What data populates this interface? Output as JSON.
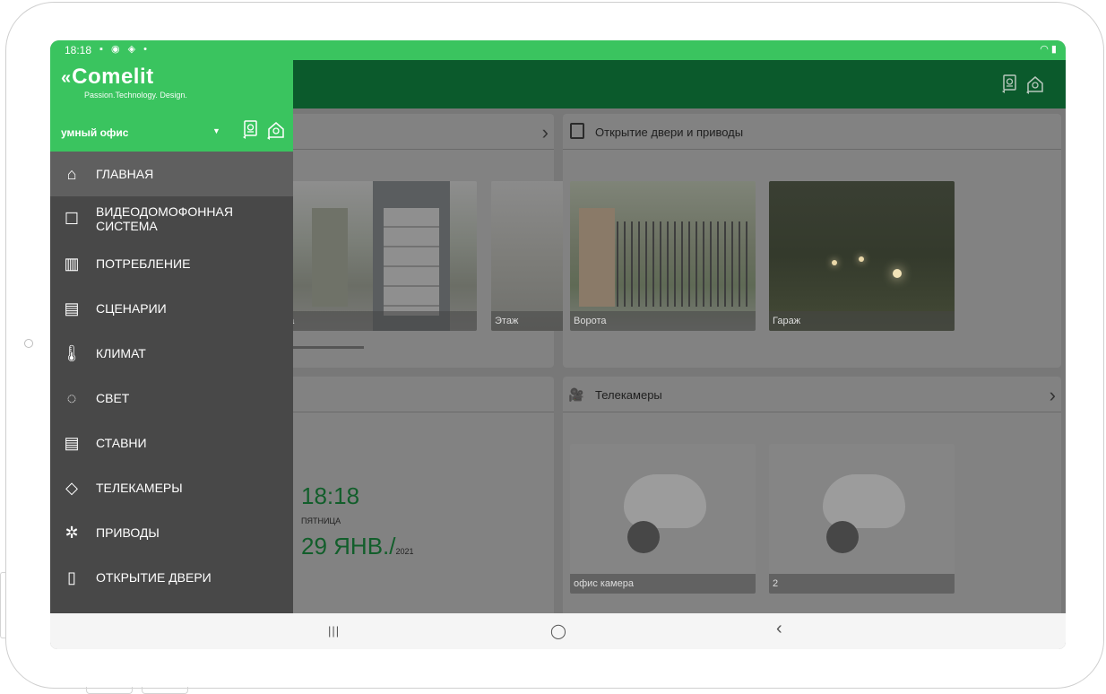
{
  "status_bar": {
    "time": "18:18",
    "icons": "▪ ◉ ◈ •",
    "right_icons": "◠ ▮"
  },
  "drawer": {
    "brand": "Comelit",
    "brand_mark": "«",
    "tagline": "Passion.Technology. Design.",
    "site_name": "умный офис",
    "site_caret": "▼",
    "menu": [
      {
        "label": "ГЛАВНАЯ",
        "icon": "home-icon",
        "glyph": "⌂"
      },
      {
        "label": "ВИДЕОДОМОФОННАЯ СИСТЕМА",
        "icon": "intercom-icon",
        "glyph": "☐"
      },
      {
        "label": "ПОТРЕБЛЕНИЕ",
        "icon": "energy-chart-icon",
        "glyph": "▥"
      },
      {
        "label": "СЦЕНАРИИ",
        "icon": "clapperboard-icon",
        "glyph": "▤"
      },
      {
        "label": "КЛИМАТ",
        "icon": "thermometer-icon",
        "glyph": "🌡"
      },
      {
        "label": "СВЕТ",
        "icon": "lightbulb-icon",
        "glyph": "◌"
      },
      {
        "label": "СТАВНИ",
        "icon": "shutter-icon",
        "glyph": "▤"
      },
      {
        "label": "ТЕЛЕКАМЕРЫ",
        "icon": "camera-icon",
        "glyph": "◇"
      },
      {
        "label": "ПРИВОДЫ",
        "icon": "actuators-icon",
        "glyph": "✲"
      },
      {
        "label": "ОТКРЫТИЕ ДВЕРИ",
        "icon": "door-icon",
        "glyph": "▯"
      }
    ]
  },
  "main": {
    "doors_card": {
      "title": "Открытие двери и приводы",
      "tiles": [
        "Ворота",
        "Гараж"
      ]
    },
    "intercom_card": {
      "tiles": [
        "тка",
        "Этаж"
      ]
    },
    "cameras_card": {
      "title": "Телекамеры",
      "tiles": [
        "офис камера",
        "2"
      ]
    },
    "clock": {
      "time": "18:18",
      "weekday": "ПЯТНИЦА",
      "date": "29 ЯНВ./",
      "year": "2021"
    }
  },
  "nav_bar": {
    "recents": "|||",
    "home": "◯",
    "back": "‹"
  },
  "colors": {
    "status_green": "#3ac45f",
    "appbar_green": "#0b5a2c",
    "drawer_bg": "#484848",
    "clock_green": "#125e2b"
  }
}
